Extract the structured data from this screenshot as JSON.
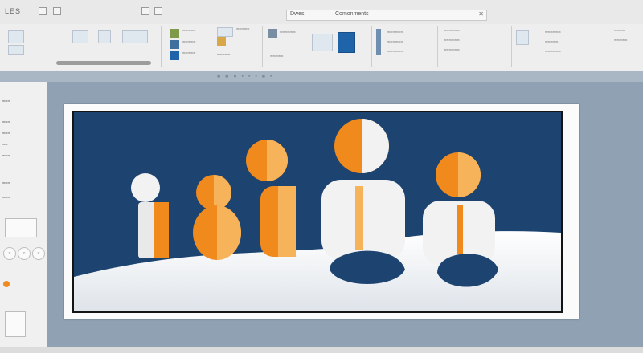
{
  "window": {
    "app_title": "LES",
    "title_field_label": "Dwes",
    "title_field_name": "Comonments",
    "close_glyph": "✕"
  },
  "ribbon": {
    "groups": [
      {
        "labels": []
      },
      {
        "labels": [
          "≈≈≈≈≈",
          "≈≈≈≈≈",
          "≈≈≈≈≈"
        ]
      },
      {
        "labels": [
          "≈≈≈≈≈",
          "≈≈≈≈≈"
        ]
      },
      {
        "labels": [
          "≈≈≈≈≈≈",
          "≈≈≈≈≈"
        ]
      },
      {
        "labels": [
          "≈≈≈≈≈≈",
          "≈≈≈≈≈≈",
          "≈≈≈≈≈≈"
        ]
      },
      {
        "labels": [
          "≈≈≈≈",
          "≈≈≈≈≈"
        ]
      }
    ],
    "accent_colors": {
      "blue": "#1f64a8",
      "olive": "#7f9a4a",
      "steel": "#3f6f9e",
      "gold": "#d8a74a"
    }
  },
  "left_panel": {
    "items": [
      "≈≈≈",
      "≈≈≈",
      "≈≈≈",
      "≈≈",
      "≈≈≈",
      "≈≈≈",
      "≈≈≈"
    ],
    "pill_labels": [
      "≈",
      "≈",
      "≈"
    ]
  },
  "slide": {
    "illustration": "orange-white-figures-on-navy",
    "colors": {
      "navy": "#1d4470",
      "orange": "#f08a1c",
      "white": "#f2f2f2"
    }
  }
}
